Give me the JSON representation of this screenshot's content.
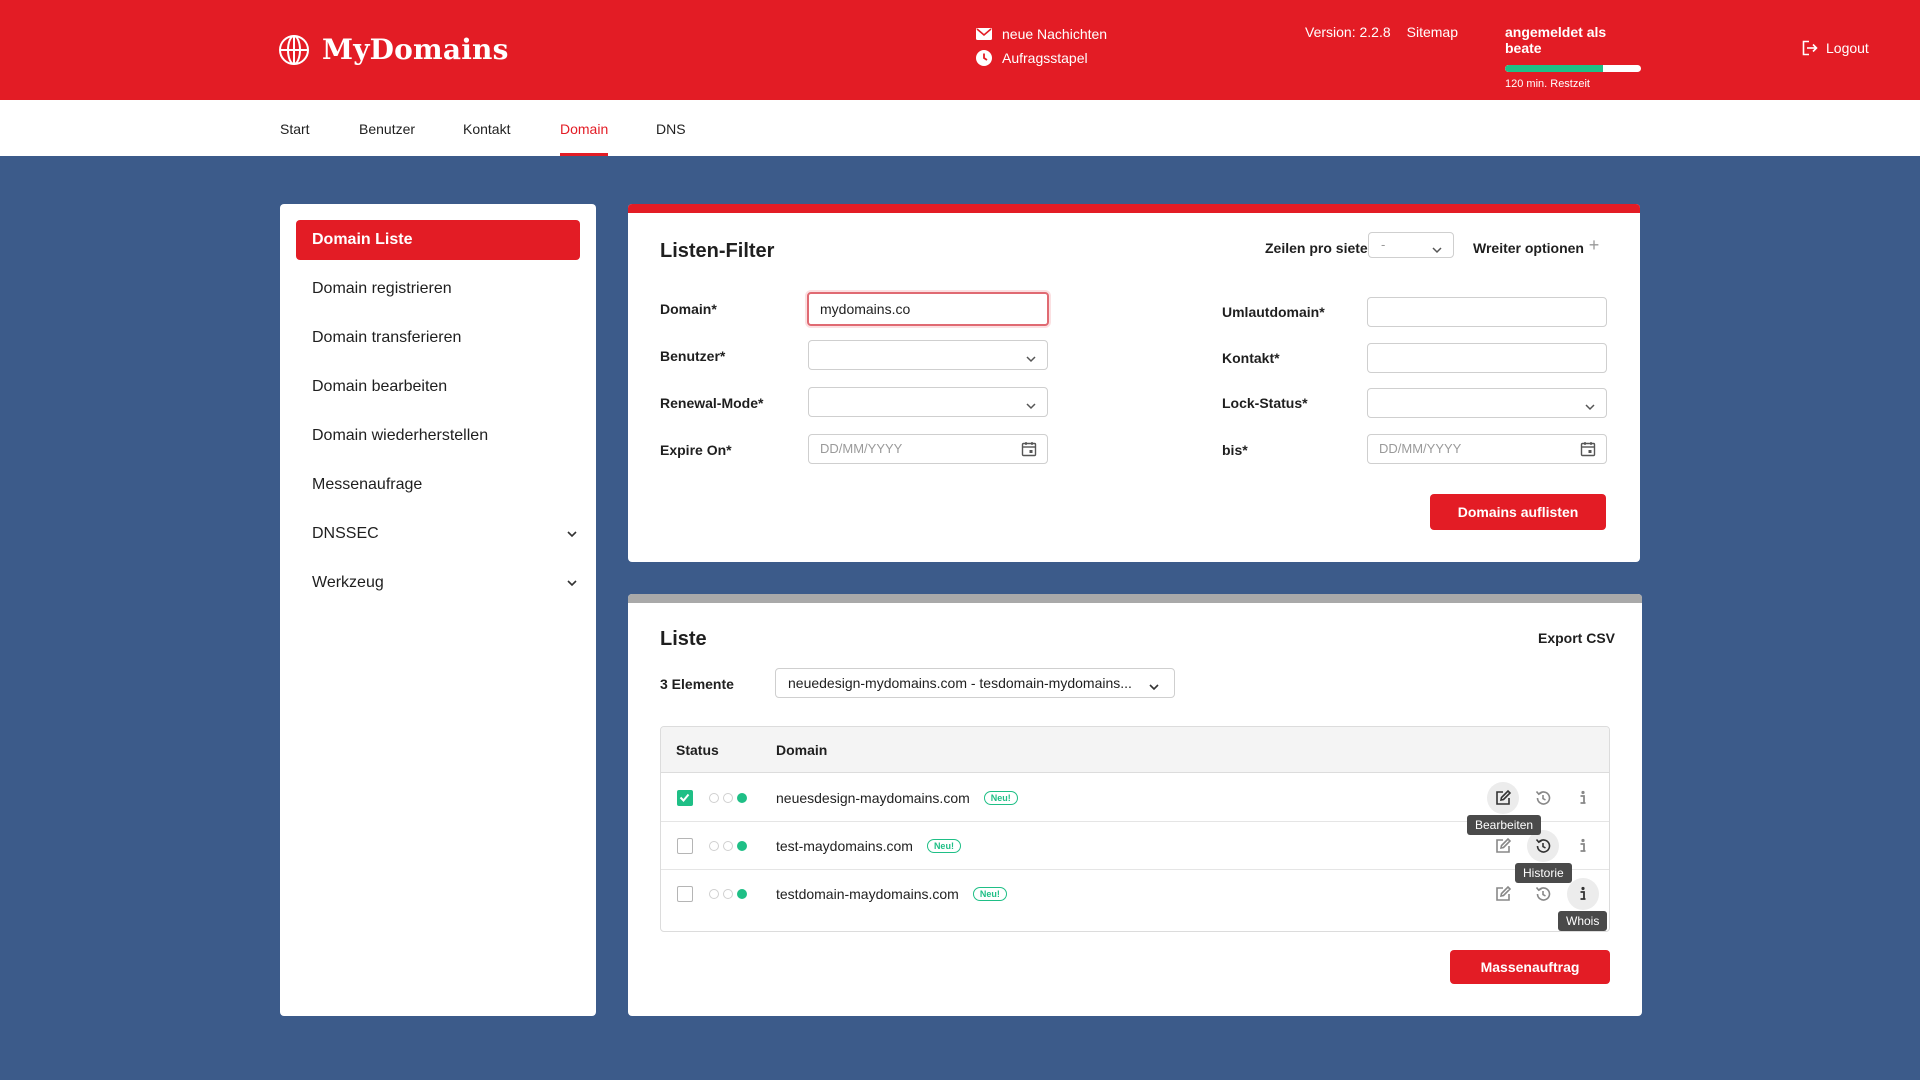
{
  "header": {
    "logo": "MyDomains",
    "messages": "neue Nachichten",
    "queue": "Aufragsstapel",
    "version": "Version: 2.2.8",
    "sitemap": "Sitemap",
    "user": "angemeldet als beate",
    "session_fraction": 0.72,
    "session_remaining": "120 min. Restzeit",
    "logout": "Logout",
    "brand_color": "#e31c25",
    "accent_color": "#1fbf86"
  },
  "nav": {
    "items": [
      "Start",
      "Benutzer",
      "Kontakt",
      "Domain",
      "DNS"
    ],
    "active": "Domain"
  },
  "sidebar": {
    "items": [
      {
        "label": "Domain Liste",
        "active": true
      },
      {
        "label": "Domain registrieren"
      },
      {
        "label": "Domain transferieren"
      },
      {
        "label": "Domain bearbeiten"
      },
      {
        "label": "Domain wiederherstellen"
      },
      {
        "label": "Messenaufrage"
      },
      {
        "label": "DNSSEC",
        "expandable": true
      },
      {
        "label": "Werkzeug",
        "expandable": true
      }
    ]
  },
  "filter": {
    "title": "Listen-Filter",
    "rows_label": "Zeilen pro siete",
    "rows_value": "-",
    "more_options": "Wreiter optionen",
    "fields": {
      "domain_label": "Domain*",
      "domain_value": "mydomains.co",
      "user_label": "Benutzer*",
      "renewal_label": "Renewal-Mode*",
      "expire_label": "Expire On*",
      "expire_placeholder": "DD/MM/YYYY",
      "umlaut_label": "Umlautdomain*",
      "contact_label": "Kontakt*",
      "lock_label": "Lock-Status*",
      "to_label": "bis*",
      "to_placeholder": "DD/MM/YYYY"
    },
    "submit": "Domains auflisten"
  },
  "list": {
    "title": "Liste",
    "export": "Export CSV",
    "count": "3 Elemente",
    "selection": "neuedesign-mydomains.com - tesdomain-mydomains...",
    "columns": [
      "Status",
      "Domain"
    ],
    "rows": [
      {
        "domain": "neuesdesign-maydomains.com",
        "badge": "Neu!",
        "checked": true
      },
      {
        "domain": "test-maydomains.com",
        "badge": "Neu!",
        "checked": false
      },
      {
        "domain": "testdomain-maydomains.com",
        "badge": "Neu!",
        "checked": false
      }
    ],
    "tooltips": {
      "edit": "Bearbeiten",
      "history": "Historie",
      "whois": "Whois"
    },
    "mass_action": "Massenauftrag"
  }
}
